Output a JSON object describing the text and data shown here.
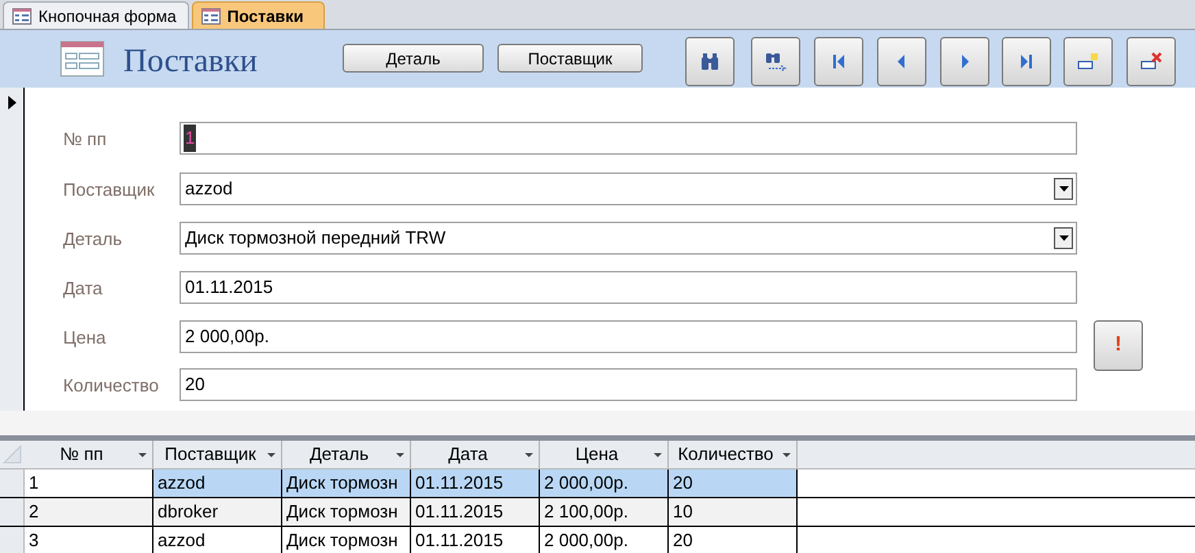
{
  "tabs": [
    {
      "label": "Кнопочная форма",
      "selected": false
    },
    {
      "label": "Поставки",
      "selected": true
    }
  ],
  "form": {
    "title": "Поставки",
    "buttons": [
      "Деталь",
      "Поставщик"
    ],
    "toolbar": [
      {
        "kind": "find"
      },
      {
        "kind": "find-next"
      },
      {
        "kind": "first"
      },
      {
        "kind": "prev"
      },
      {
        "kind": "next"
      },
      {
        "kind": "last"
      },
      {
        "kind": "new"
      },
      {
        "kind": "delete"
      }
    ],
    "fields": [
      {
        "label": "№ пп",
        "value": "1",
        "kind": "text",
        "focused": true
      },
      {
        "label": "Поставщик",
        "value": "azzod",
        "kind": "combo",
        "focused": false
      },
      {
        "label": "Деталь",
        "value": "Диск тормозной передний TRW",
        "kind": "combo",
        "focused": false
      },
      {
        "label": "Дата",
        "value": "01.11.2015",
        "kind": "text",
        "focused": false
      },
      {
        "label": "Цена",
        "value": "2 000,00р.",
        "kind": "text",
        "focused": false
      },
      {
        "label": "Количество",
        "value": "20",
        "kind": "text",
        "focused": false
      }
    ],
    "alert_button": "!"
  },
  "table": {
    "columns": [
      "№ пп",
      "Поставщик",
      "Деталь",
      "Дата",
      "Цена",
      "Количество"
    ],
    "rows": [
      {
        "cells": [
          "1",
          "azzod",
          "Диск тормозн",
          "01.11.2015",
          "2 000,00р.",
          "20"
        ],
        "selected": true
      },
      {
        "cells": [
          "2",
          "dbroker",
          "Диск тормозн",
          "01.11.2015",
          "2 100,00р.",
          "10"
        ],
        "selected": false
      },
      {
        "cells": [
          "3",
          "azzod",
          "Диск тормозн",
          "01.11.2015",
          "2 000,00р.",
          "20"
        ],
        "selected": false
      }
    ]
  }
}
